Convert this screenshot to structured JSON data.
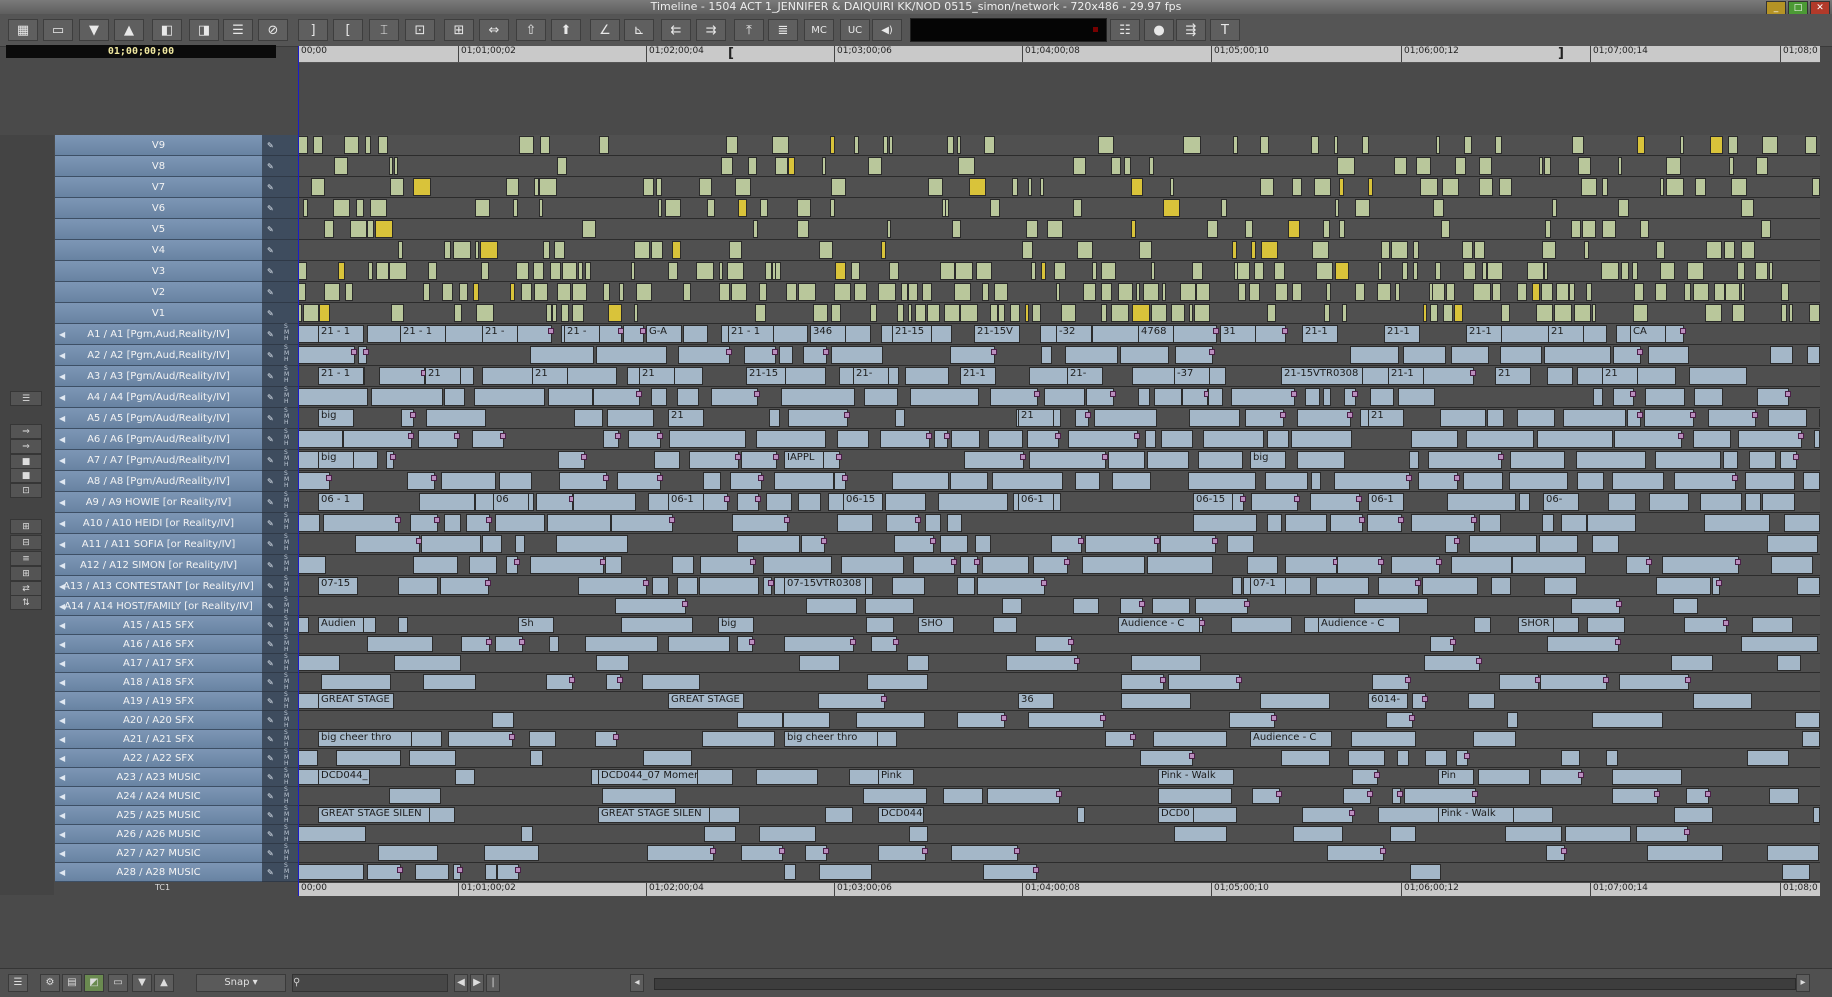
{
  "window": {
    "title": "Timeline - 1504 ACT 1_JENNIFER & DAIQUIRI KK/NOD 0515_simon/network - 720x486 - 29.97 fps",
    "buttons": [
      "_",
      "□",
      "✕"
    ]
  },
  "toolbar": {
    "buttons": [
      {
        "name": "grid-icon",
        "glyph": "▦"
      },
      {
        "name": "monitor-icon",
        "glyph": "▭"
      },
      {
        "name": "lift-down-icon",
        "glyph": "▼"
      },
      {
        "name": "extract-up-icon",
        "glyph": "▲"
      },
      {
        "name": "splice-icon",
        "glyph": "◧"
      },
      {
        "name": "overwrite-icon",
        "glyph": "◨"
      },
      {
        "name": "list-icon",
        "glyph": "☰"
      },
      {
        "name": "cancel-icon",
        "glyph": "⊘"
      },
      {
        "name": "mark-out-icon",
        "glyph": "]"
      },
      {
        "name": "mark-in-icon",
        "glyph": "["
      },
      {
        "name": "mark-clip-icon",
        "glyph": "⌶"
      },
      {
        "name": "clear-marks-icon",
        "glyph": "⊡"
      },
      {
        "name": "segment-icon",
        "glyph": "⊞"
      },
      {
        "name": "trim-icon",
        "glyph": "⇔"
      },
      {
        "name": "lift-icon",
        "glyph": "⇧"
      },
      {
        "name": "extract-icon",
        "glyph": "⬆"
      },
      {
        "name": "angle-icon",
        "glyph": "∠"
      },
      {
        "name": "angle2-icon",
        "glyph": "⊾"
      },
      {
        "name": "slip-left-icon",
        "glyph": "⇇"
      },
      {
        "name": "slip-right-icon",
        "glyph": "⇉"
      },
      {
        "name": "top-icon",
        "glyph": "⤒"
      },
      {
        "name": "menu-icon",
        "glyph": "≣"
      },
      {
        "name": "mc-button",
        "glyph": "MC"
      },
      {
        "name": "uc-button",
        "glyph": "UC"
      },
      {
        "name": "speaker-icon",
        "glyph": "◀)"
      }
    ],
    "right_buttons": [
      {
        "name": "list2-icon",
        "glyph": "☷"
      },
      {
        "name": "record-icon",
        "glyph": "●"
      },
      {
        "name": "output-icon",
        "glyph": "⇶"
      },
      {
        "name": "text-icon",
        "glyph": "T"
      }
    ]
  },
  "timecode": "01;00;00;00",
  "ruler": {
    "ticks": [
      "00;00",
      "01;01;00;02",
      "01;02;00;04",
      "01;03;00;06",
      "01;04;00;08",
      "01;05;00;10",
      "01;06;00;12",
      "01;07;00;14",
      "01;08;0"
    ]
  },
  "tracks": [
    {
      "label": "V9",
      "kind": "v"
    },
    {
      "label": "V8",
      "kind": "v"
    },
    {
      "label": "V7",
      "kind": "v"
    },
    {
      "label": "V6",
      "kind": "v"
    },
    {
      "label": "V5",
      "kind": "v"
    },
    {
      "label": "V4",
      "kind": "v"
    },
    {
      "label": "V3",
      "kind": "v"
    },
    {
      "label": "V2",
      "kind": "v"
    },
    {
      "label": "V1",
      "kind": "v"
    },
    {
      "label": "A1 / A1 [Pgm,Aud,Reality/IV]",
      "kind": "a"
    },
    {
      "label": "A2 / A2 [Pgm,Aud,Reality/IV]",
      "kind": "a"
    },
    {
      "label": "A3 / A3 [Pgm/Aud/Reality/IV]",
      "kind": "a"
    },
    {
      "label": "A4 / A4 [Pgm/Aud/Reality/IV]",
      "kind": "a"
    },
    {
      "label": "A5 / A5 [Pgm/Aud/Reality/IV]",
      "kind": "a"
    },
    {
      "label": "A6 / A6 [Pgm/Aud/Reality/IV]",
      "kind": "a"
    },
    {
      "label": "A7 / A7 [Pgm/Aud/Reality/IV]",
      "kind": "a"
    },
    {
      "label": "A8 / A8 [Pgm/Aud/Reality/IV]",
      "kind": "a"
    },
    {
      "label": "A9 / A9 HOWIE [or Reality/IV]",
      "kind": "a"
    },
    {
      "label": "A10 / A10 HEIDI [or Reality/IV]",
      "kind": "a"
    },
    {
      "label": "A11 / A11 SOFIA [or Reality/IV]",
      "kind": "a"
    },
    {
      "label": "A12 / A12 SIMON [or Reality/IV]",
      "kind": "a"
    },
    {
      "label": "A13 / A13 CONTESTANT [or Reality/IV]",
      "kind": "a"
    },
    {
      "label": "A14 / A14 HOST/FAMILY [or Reality/IV]",
      "kind": "a"
    },
    {
      "label": "A15 / A15 SFX",
      "kind": "a"
    },
    {
      "label": "A16 / A16 SFX",
      "kind": "a"
    },
    {
      "label": "A17 / A17 SFX",
      "kind": "a"
    },
    {
      "label": "A18 / A18 SFX",
      "kind": "a"
    },
    {
      "label": "A19 / A19 SFX",
      "kind": "a"
    },
    {
      "label": "A20 / A20 SFX",
      "kind": "a"
    },
    {
      "label": "A21 / A21 SFX",
      "kind": "a"
    },
    {
      "label": "A22 / A22 SFX",
      "kind": "a"
    },
    {
      "label": "A23 / A23 MUSIC",
      "kind": "a"
    },
    {
      "label": "A24 / A24 MUSIC",
      "kind": "a"
    },
    {
      "label": "A25 / A25 MUSIC",
      "kind": "a"
    },
    {
      "label": "A26 / A26 MUSIC",
      "kind": "a"
    },
    {
      "label": "A27 / A27 MUSIC",
      "kind": "a"
    },
    {
      "label": "A28 / A28 MUSIC",
      "kind": "a"
    }
  ],
  "clip_texts": {
    "a1": [
      "21 - 1",
      "21 - 1",
      "21 -",
      "21 -",
      "G-A",
      "21 - 1",
      "346",
      "21-15",
      "21-15V",
      "-32",
      "4768",
      "31",
      "21-1",
      "21-1",
      "21-1",
      "21",
      "CA"
    ],
    "a3": [
      "21 - 1",
      "21",
      "21",
      "21",
      "21-15",
      "21-",
      "21-1",
      "21-",
      "-37",
      "21-15VTR0308",
      "21-1",
      "21",
      "21"
    ],
    "a5": [
      "big",
      "21",
      "21",
      "21"
    ],
    "a7": [
      "big",
      "IAPPL",
      "big"
    ],
    "a9": [
      "06 - 1",
      "06",
      "06-1",
      "06-15",
      "06-1",
      "06-15",
      "06-1",
      "06-"
    ],
    "a13": [
      "07-15",
      "07-15VTR0308",
      "07-1"
    ],
    "a15": [
      "Audien",
      "Sh",
      "big",
      "SHO",
      "Audience - C",
      "Audience - C",
      "SHOR"
    ],
    "a19": [
      "GREAT STAGE",
      "GREAT STAGE",
      "36",
      "6014-"
    ],
    "a21": [
      "big cheer thro",
      "big cheer thro",
      "Audience - C"
    ],
    "a23": [
      "DCD044_",
      "DCD044_07 Momen",
      "Pink",
      "Pink - Walk",
      "Pin"
    ],
    "a25": [
      "GREAT STAGE SILEN",
      "GREAT STAGE SILEN",
      "DCD044",
      "DCD0",
      "Pink - Walk"
    ]
  },
  "gutter_buttons": [
    "☰",
    "⇒",
    "⇒",
    "■",
    "■",
    "⊡",
    "⊞",
    "⊟",
    "≡",
    "⊞",
    "⇄",
    "⇅"
  ],
  "bottom": {
    "snap_label": "Snap",
    "find_placeholder": "",
    "tc1": "TC1"
  }
}
